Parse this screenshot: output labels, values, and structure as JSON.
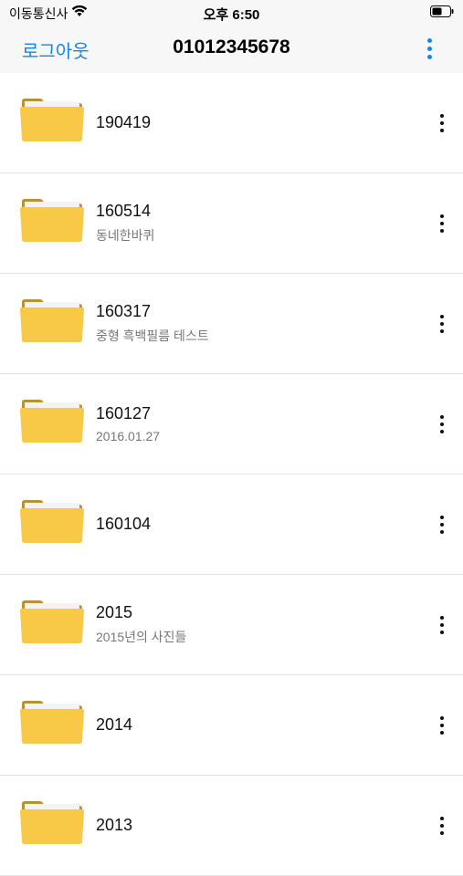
{
  "status_bar": {
    "carrier": "이동통신사",
    "time": "오후 6:50"
  },
  "nav": {
    "logout_label": "로그아웃",
    "title": "01012345678",
    "menu_icon": "more-vertical-icon",
    "accent_color": "#1a82e8"
  },
  "folders": [
    {
      "name": "190419",
      "subtitle": ""
    },
    {
      "name": "160514",
      "subtitle": "동네한바퀴"
    },
    {
      "name": "160317",
      "subtitle": "중형 흑백필름 테스트"
    },
    {
      "name": "160127",
      "subtitle": "2016.01.27"
    },
    {
      "name": "160104",
      "subtitle": ""
    },
    {
      "name": "2015",
      "subtitle": "2015년의 사진들"
    },
    {
      "name": "2014",
      "subtitle": ""
    },
    {
      "name": "2013",
      "subtitle": ""
    }
  ]
}
